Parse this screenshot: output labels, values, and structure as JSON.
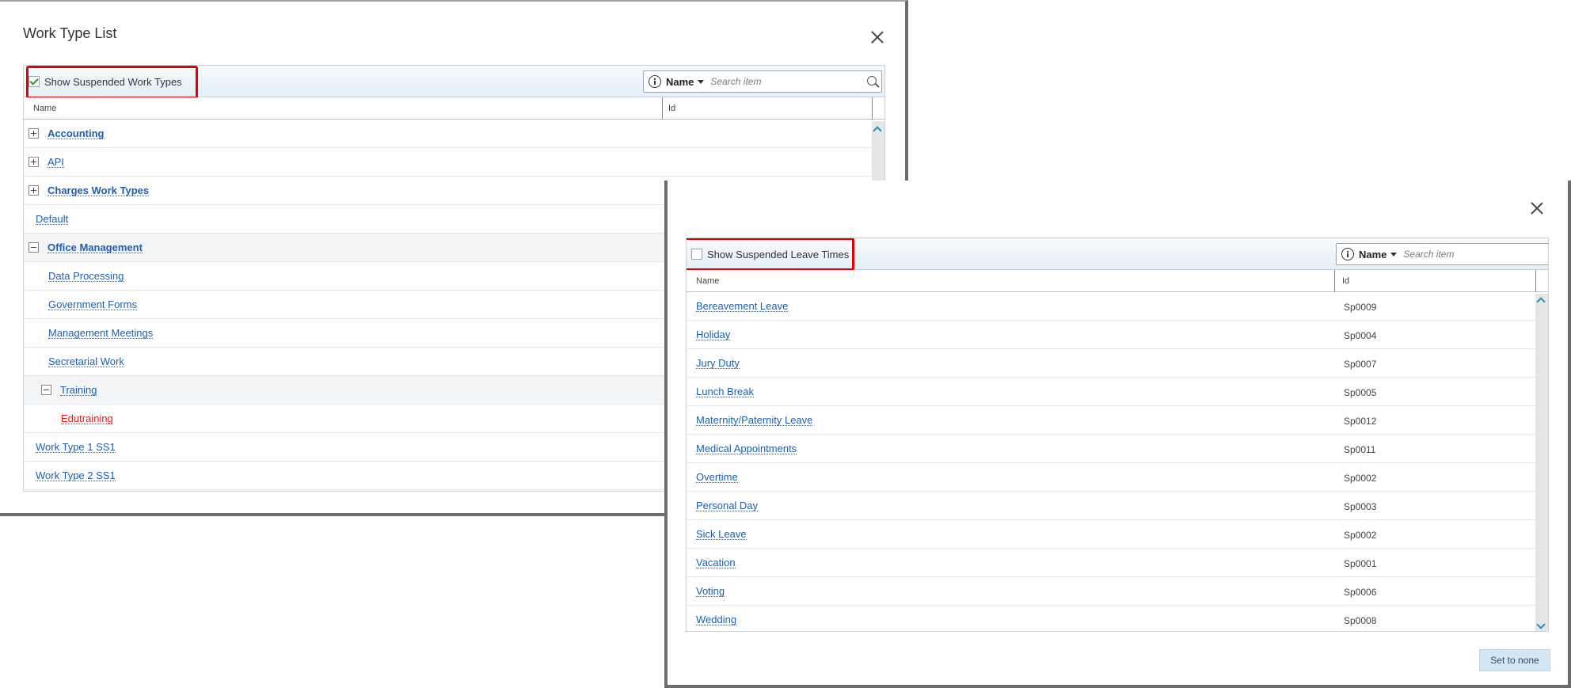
{
  "work_type_dialog": {
    "title": "Work Type List",
    "show_suspended_label": "Show Suspended Work Types",
    "show_suspended_checked": true,
    "search_field": "Name",
    "search_placeholder": "Search item",
    "columns": {
      "name": "Name",
      "id": "Id"
    },
    "rows": [
      {
        "label": "Accounting",
        "level": 0,
        "expander": "plus",
        "bold": true
      },
      {
        "label": "API",
        "level": 0,
        "expander": "plus",
        "bold": false
      },
      {
        "label": "Charges Work Types",
        "level": 0,
        "expander": "plus",
        "bold": true
      },
      {
        "label": "Default",
        "level": 0,
        "expander": "none",
        "bold": false
      },
      {
        "label": "Office Management",
        "level": 0,
        "expander": "minus",
        "bold": true
      },
      {
        "label": "Data Processing",
        "level": 1,
        "expander": "none",
        "bold": false
      },
      {
        "label": "Government Forms",
        "level": 1,
        "expander": "none",
        "bold": false
      },
      {
        "label": "Management Meetings",
        "level": 1,
        "expander": "none",
        "bold": false
      },
      {
        "label": "Secretarial Work",
        "level": 1,
        "expander": "none",
        "bold": false
      },
      {
        "label": "Training",
        "level": 1,
        "expander": "minus",
        "bold": false
      },
      {
        "label": "Edutraining",
        "level": 2,
        "expander": "none",
        "bold": false,
        "suspended": true
      },
      {
        "label": "Work Type 1 SS1",
        "level": 0,
        "expander": "none",
        "bold": false
      },
      {
        "label": "Work Type 2 SS1",
        "level": 0,
        "expander": "none",
        "bold": false
      }
    ]
  },
  "leave_time_dialog": {
    "show_suspended_label": "Show Suspended Leave Times",
    "show_suspended_checked": false,
    "search_field": "Name",
    "search_placeholder": "Search item",
    "columns": {
      "name": "Name",
      "id": "Id"
    },
    "rows": [
      {
        "name": "Bereavement Leave",
        "id": "Sp0009"
      },
      {
        "name": "Holiday",
        "id": "Sp0004"
      },
      {
        "name": "Jury Duty",
        "id": "Sp0007"
      },
      {
        "name": "Lunch Break",
        "id": "Sp0005"
      },
      {
        "name": "Maternity/Paternity Leave",
        "id": "Sp0012"
      },
      {
        "name": "Medical Appointments",
        "id": "Sp0011"
      },
      {
        "name": "Overtime",
        "id": "Sp0002"
      },
      {
        "name": "Personal Day",
        "id": "Sp0003"
      },
      {
        "name": "Sick Leave",
        "id": "Sp0002"
      },
      {
        "name": "Vacation",
        "id": "Sp0001"
      },
      {
        "name": "Voting",
        "id": "Sp0006"
      },
      {
        "name": "Wedding",
        "id": "Sp0008"
      }
    ],
    "set_to_none_label": "Set to none"
  },
  "colors": {
    "link": "#1f5fad",
    "suspended": "#e01c1c",
    "highlight": "#e00000",
    "scroll_arrow": "#1e90b8"
  }
}
